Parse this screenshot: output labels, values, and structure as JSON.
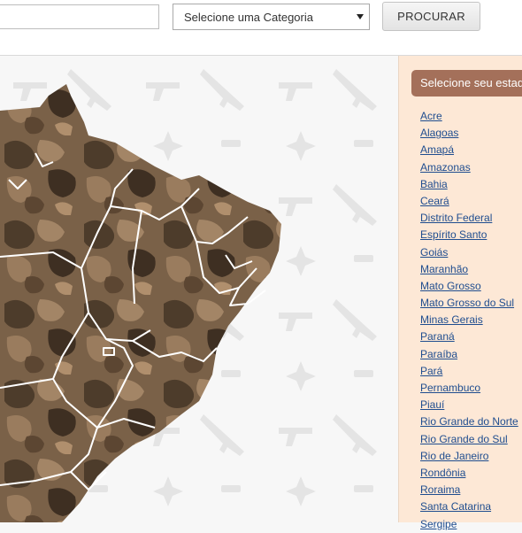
{
  "search": {
    "value": "",
    "placeholder": ""
  },
  "category_select": {
    "selected": "Selecione uma Categoria",
    "icon": "chevron-down-icon"
  },
  "search_button": {
    "label": "PROCURAR"
  },
  "sidebar": {
    "title": "Selecione seu estado",
    "states": [
      "Acre",
      "Alagoas",
      "Amapá",
      "Amazonas",
      "Bahia",
      "Ceará",
      "Distrito Federal",
      "Espírito Santo",
      "Goiás",
      "Maranhão",
      "Mato Grosso",
      "Mato Grosso do Sul",
      "Minas Gerais",
      "Paraná",
      "Paraíba",
      "Pará",
      "Pernambuco",
      "Piauí",
      "Rio Grande do Norte",
      "Rio Grande do Sul",
      "Rio de Janeiro",
      "Rondônia",
      "Roraima",
      "Santa Catarina",
      "Sergipe"
    ]
  },
  "map": {
    "icon": "brazil-map",
    "colors": {
      "dark": "#4d3c2b",
      "mid": "#7a6148",
      "light": "#a38566",
      "border": "#ffffff"
    }
  },
  "background": {
    "icons": [
      "pistol-icon",
      "rifle-icon",
      "shuriken-icon",
      "ammo-icon"
    ],
    "color": "#e6e6e6"
  }
}
